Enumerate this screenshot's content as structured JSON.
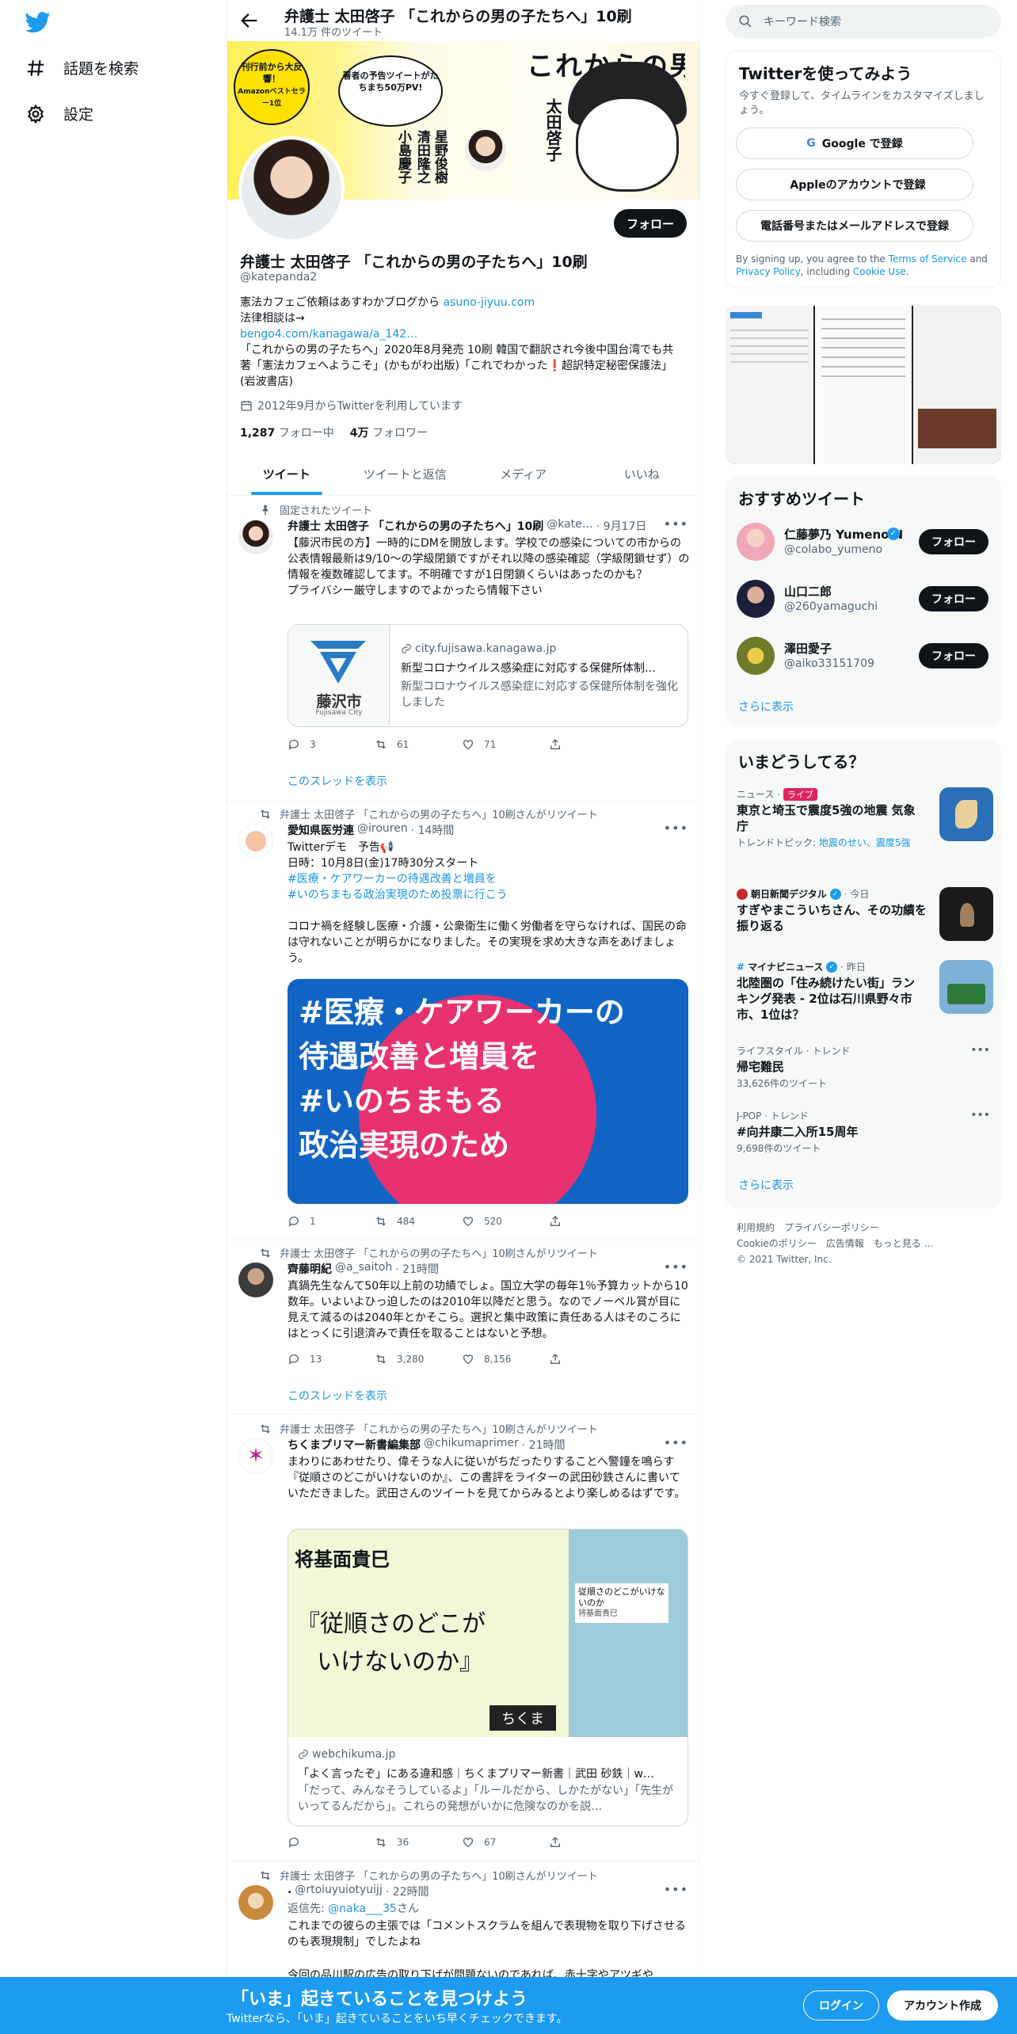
{
  "nav": {
    "explore": "話題を検索",
    "settings": "設定"
  },
  "header": {
    "title": "弁護士 太田啓子 「これからの男の子たちへ」10刷",
    "subtitle": "14.1万 件のツイート"
  },
  "banner": {
    "badge": "刊行前から大反響！",
    "badge_sub": "Amazonベストセラー1位",
    "bubble": "著者の予告ツイートがたちまち50万PV!",
    "title": "これからの男の子たちへ",
    "author": "太田啓子",
    "guests": [
      "小島慶子",
      "清田隆之",
      "星野俊樹"
    ]
  },
  "profile": {
    "follow": "フォロー",
    "name": "弁護士 太田啓子 「これからの男の子たちへ」10刷",
    "handle": "@katepanda2",
    "bio1": "憲法カフェご依頼はあすわかブログから ",
    "bio1_link": "asuno-jiyuu.com",
    "bio2": "法律相談は→",
    "bio3_link": "bengo4.com/kanagawa/a_142…",
    "bio4": "「これからの男の子たちへ」2020年8月発売 10刷 韓国で翻訳され今後中国台湾でも共著「憲法カフェへようこそ」(かもがわ出版)「これでわかった",
    "bio4_b": "超訳特定秘密保護法」(岩波書店)",
    "joined": "2012年9月からTwitterを利用しています",
    "following_n": "1,287",
    "following_l": "フォロー中",
    "followers_n": "4万",
    "followers_l": "フォロワー"
  },
  "tabs": [
    "ツイート",
    "ツイートと返信",
    "メディア",
    "いいね"
  ],
  "tweets": [
    {
      "context": "固定されたツイート",
      "name": "弁護士 太田啓子 「これからの男の子たちへ」10刷",
      "handle": "@kate…",
      "time": "· 9月17日",
      "text": "【藤沢市民の方】一時的にDMを開放します。学校での感染についての市からの公表情報最新は9/10～の学級閉鎖ですがそれ以降の感染確認（学級閉鎖せず）の情報を複数確認してます。不明確ですが1日閉鎖くらいはあったのかも？\nプライバシー厳守しますのでよかったら情報下さい",
      "card_domain": "city.fujisawa.kanagawa.jp",
      "card_title": "新型コロナウイルス感染症に対応する保健所体制…",
      "card_desc": "新型コロナウイルス感染症に対応する保健所体制を強化しました",
      "card_logo": "藤沢市",
      "card_logo_sub": "Fujisawa City",
      "reply": "3",
      "rt": "61",
      "like": "71",
      "thread": "このスレッドを表示"
    },
    {
      "context": "弁護士 太田啓子 「これからの男の子たちへ」10刷さんがリツイート",
      "name": "愛知県医労連",
      "handle": "@irouren",
      "time": "· 14時間",
      "line1": "Twitterデモ　予告📢",
      "line2": "日時：10月8日(金)17時30分スタート",
      "tag1": "#医療・ケアワーカーの待遇改善と増員を",
      "tag2": "#いのちまもる政治実現のため投票に行こう",
      "line3": "コロナ禍を経験し医療・介護・公衆衛生に働く労働者を守らなければ、国民の命は守れないことが明らかになりました。その実現を求め大きな声をあげましょう。",
      "img_l1": "#医療・ケアワーカーの",
      "img_l2": "待遇改善と増員を",
      "img_l3": "#いのちまもる",
      "img_l4": "政治実現のため",
      "reply": "1",
      "rt": "484",
      "like": "520"
    },
    {
      "context": "弁護士 太田啓子 「これからの男の子たちへ」10刷さんがリツイート",
      "name": "齊藤明紀",
      "handle": "@a_saitoh",
      "time": "· 21時間",
      "text": "真鍋先生なんて50年以上前の功績でしょ。国立大学の毎年1％予算カットから10数年。いよいよひっ迫したのは2010年以降だと思う。なのでノーベル賞が目に見えて減るのは2040年とかそこら。選択と集中政策に責任ある人はそのころにはとっくに引退済みで責任を取ることはないと予想。",
      "reply": "13",
      "rt": "3,280",
      "like": "8,156",
      "thread": "このスレッドを表示"
    },
    {
      "context": "弁護士 太田啓子 「これからの男の子たちへ」10刷さんがリツイート",
      "name": "ちくまプリマー新書編集部",
      "handle": "@chikumaprimer",
      "time": "· 21時間",
      "text": "まわりにあわせたり、偉そうな人に従いがちだったりすることへ警鐘を鳴らす『従順さのどこがいけないのか』、この書評をライターの武田砂鉄さんに書いていただきました。武田さんのツイートを見てからみるとより楽しめるはずです。",
      "img_author": "将基面貴巳",
      "img_title1": "『従順さのどこが",
      "img_title2": "いけないのか』",
      "img_pub": "ちくま",
      "img_book": "従順さのどこがいけないのか",
      "img_book_author": "将基面貴巳",
      "card_domain": "webchikuma.jp",
      "card_title": "「よく言ったぞ」にある違和感｜ちくまプリマー新書｜武田 砂鉄｜w…",
      "card_desc": "「だって、みんなそうしているよ」「ルールだから、しかたがない」「先生がいってるんだから」。これらの発想がいかに危険なのかを説…",
      "reply": "",
      "rt": "36",
      "like": "67"
    },
    {
      "context": "弁護士 太田啓子 「これからの男の子たちへ」10刷さんがリツイート",
      "name": ".",
      "handle": "@rtoiuyuiotyuijj",
      "time": "· 22時間",
      "reply_to": "返信先: ",
      "reply_to_handle": "@naka___35",
      "reply_to_suffix": "さん",
      "text": "これまでの彼らの主張では「コメントスクラムを組んで表現物を取り下げさせるのも表現規制」でしたよね",
      "text2": "今回の品川駅の広告の取り下げが問題ないのであれば、赤十字やアツギや"
    }
  ],
  "right": {
    "search_placeholder": "キーワード検索",
    "signup_title": "Twitterを使ってみよう",
    "signup_sub": "今すぐ登録して、タイムラインをカスタマイズしましょう。",
    "google": "Google で登録",
    "apple": "Appleのアカウントで登録",
    "phone": "電話番号またはメールアドレスで登録",
    "terms_pre": "By signing up, you agree to the ",
    "terms": "Terms of Service",
    "terms_and": " and ",
    "privacy": "Privacy Policy",
    "terms_incl": ", including ",
    "cookie": "Cookie Use",
    "terms_end": ".",
    "rec_title": "おすすめツイート",
    "suggestions": [
      {
        "name": "仁藤夢乃 Yumeno N",
        "handle": "@colabo_yumeno",
        "btn": "フォロー"
      },
      {
        "name": "山口二郎",
        "handle": "@260yamaguchi",
        "btn": "フォロー"
      },
      {
        "name": "澤田愛子",
        "handle": "@aiko33151709",
        "btn": "フォロー"
      }
    ],
    "show_more": "さらに表示",
    "trends_title": "いまどうしてる？",
    "t1_meta": "ニュース · ",
    "t1_live": "ライブ",
    "t1_title": "東京と埼玉で震度5強の地震 気象庁",
    "t1_sub": "トレンドトピック: ",
    "t1_sub_link": "地震のせい、震度5強",
    "t2_meta": "朝日新聞デジタル",
    "t2_time": "· 今日",
    "t2_title": "すぎやまこういちさん、その功績を振り返る",
    "t3_meta": "マイナビニュース",
    "t3_time": "· 昨日",
    "t3_title": "北陸圏の「住み続けたい街」ランキング発表 - 2位は石川県野々市市、1位は？",
    "t4_meta": "ライフスタイル · トレンド",
    "t4_title": "帰宅難民",
    "t4_count": "33,626件のツイート",
    "t5_meta": "J-POP · トレンド",
    "t5_title": "#向井康二入所15周年",
    "t5_count": "9,698件のツイート",
    "trend_more": "さらに表示",
    "footer1": "利用規約　プライバシーポリシー",
    "footer2": "Cookieのポリシー　広告情報　もっと見る …",
    "footer3": "© 2021 Twitter, Inc."
  },
  "bottombar": {
    "title": "「いま」起きていることを見つけよう",
    "sub": "Twitterなら、「いま」起きていることをいち早くチェックできます。",
    "login": "ログイン",
    "signup": "アカウント作成"
  },
  "colors": {
    "accent": "#1d9bf0",
    "link": "#1b95e0",
    "dark": "#0f1419"
  }
}
